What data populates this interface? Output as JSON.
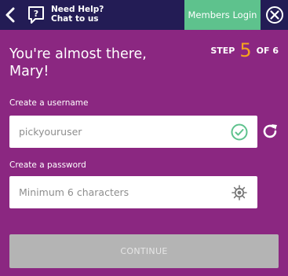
{
  "topbar": {
    "help_line1": "Need Help?",
    "help_line2": "Chat to us",
    "members_label": "Members Login"
  },
  "heading": {
    "line1": "You're almost there,",
    "line2": "Mary!"
  },
  "step": {
    "prefix": "STEP",
    "current": "5",
    "suffix": "OF 6"
  },
  "username": {
    "label": "Create a username",
    "value": "pickyouruser"
  },
  "password": {
    "label": "Create a password",
    "placeholder": "Minimum 6 characters"
  },
  "continue_label": "CONTINUE",
  "colors": {
    "background": "#8b2781",
    "topbar": "#231c55",
    "members": "#5ec28d",
    "step_number": "#f6a21e",
    "check": "#5ec28d",
    "button_disabled": "#b4b4b4"
  },
  "icons": [
    "back-arrow-icon",
    "chat-help-icon",
    "close-circle-icon",
    "check-circle-icon",
    "refresh-icon",
    "eye-icon"
  ]
}
